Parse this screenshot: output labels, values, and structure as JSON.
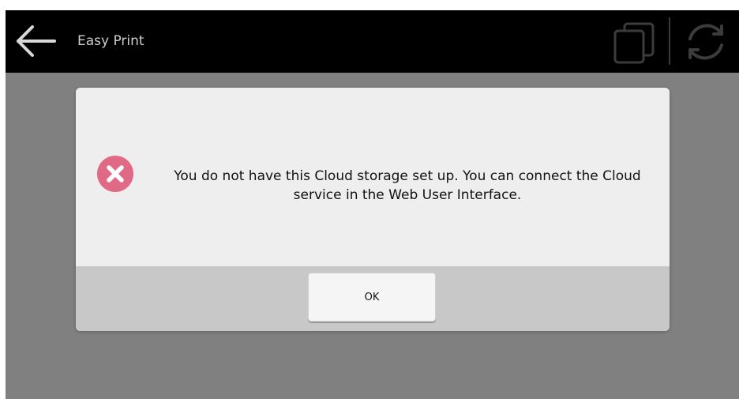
{
  "header": {
    "title": "Easy Print",
    "back_icon": "arrow-left-icon",
    "copies_icon": "copies-icon",
    "refresh_icon": "refresh-icon"
  },
  "dialog": {
    "icon": "error-circle-x-icon",
    "message": "You do not have this Cloud storage set up. You can connect the Cloud service in the Web User Interface.",
    "ok_label": "OK"
  },
  "colors": {
    "header_bg": "#000000",
    "screen_bg": "#808080",
    "dialog_bg": "#eeeeee",
    "dialog_footer_bg": "#c8c8c8",
    "error_icon": "#e06a86"
  }
}
